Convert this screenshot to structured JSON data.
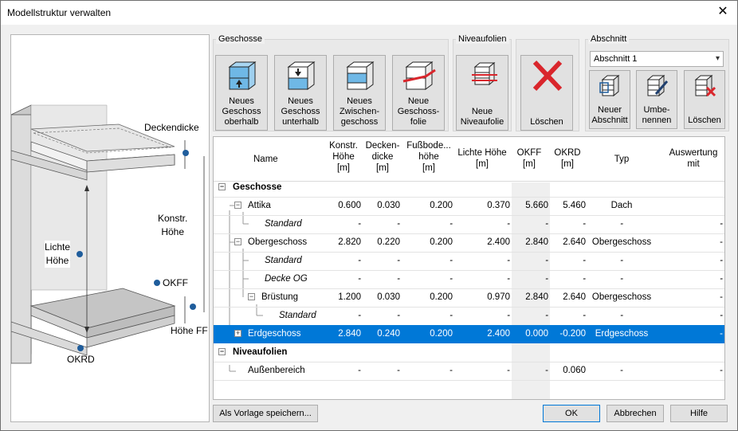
{
  "window": {
    "title": "Modellstruktur verwalten"
  },
  "illustration": {
    "deckendicke": "Deckendicke",
    "konstr_hoehe": "Konstr.\nHöhe",
    "lichte_hoehe": "Lichte\nHöhe",
    "okff": "OKFF",
    "hoehe_ff": "Höhe FF",
    "okrd": "OKRD"
  },
  "toolbar": {
    "geschosse_label": "Geschosse",
    "niveaufolien_label": "Niveaufolien",
    "abschnitt_label": "Abschnitt",
    "neues_geschoss_oberhalb": "Neues\nGeschoss\noberhalb",
    "neues_geschoss_unterhalb": "Neues\nGeschoss\nunterhalb",
    "neues_zwischengeschoss": "Neues\nZwischen-\ngeschoss",
    "neue_geschossfolie": "Neue\nGeschoss-\nfolie",
    "neue_niveaufolie": "Neue\nNiveaufolie",
    "loeschen": "Löschen",
    "abschnitt_selected": "Abschnitt 1",
    "neuer_abschnitt": "Neuer\nAbschnitt",
    "umbenennen": "Umbe-\nnennen",
    "abschnitt_loeschen": "Löschen"
  },
  "columns": {
    "name": "Name",
    "konstr": "Konstr.\nHöhe\n[m]",
    "decken": "Decken-\ndicke\n[m]",
    "fussboden": "Fußbode...\nhöhe\n[m]",
    "lichte": "Lichte Höhe\n[m]",
    "okff": "OKFF\n[m]",
    "okrd": "OKRD\n[m]",
    "typ": "Typ",
    "auswertung": "Auswertung\nmit"
  },
  "rows": [
    {
      "name": "Geschosse",
      "konstr": "",
      "decken": "",
      "fuss": "",
      "lichte": "",
      "okff": "",
      "okrd": "",
      "typ": "",
      "ausw": ""
    },
    {
      "name": "Attika",
      "konstr": "0.600",
      "decken": "0.030",
      "fuss": "0.200",
      "lichte": "0.370",
      "okff": "5.660",
      "okrd": "5.460",
      "typ": "Dach",
      "ausw": ""
    },
    {
      "name": "Standard",
      "konstr": "-",
      "decken": "-",
      "fuss": "-",
      "lichte": "-",
      "okff": "-",
      "okrd": "-",
      "typ": "-",
      "ausw": "-"
    },
    {
      "name": "Obergeschoss",
      "konstr": "2.820",
      "decken": "0.220",
      "fuss": "0.200",
      "lichte": "2.400",
      "okff": "2.840",
      "okrd": "2.640",
      "typ": "Obergeschoss",
      "ausw": "-"
    },
    {
      "name": "Standard",
      "konstr": "-",
      "decken": "-",
      "fuss": "-",
      "lichte": "-",
      "okff": "-",
      "okrd": "-",
      "typ": "-",
      "ausw": "-"
    },
    {
      "name": "Decke OG",
      "konstr": "-",
      "decken": "-",
      "fuss": "-",
      "lichte": "-",
      "okff": "-",
      "okrd": "-",
      "typ": "-",
      "ausw": "-"
    },
    {
      "name": "Brüstung",
      "konstr": "1.200",
      "decken": "0.030",
      "fuss": "0.200",
      "lichte": "0.970",
      "okff": "2.840",
      "okrd": "2.640",
      "typ": "Obergeschoss",
      "ausw": "-"
    },
    {
      "name": "Standard",
      "konstr": "-",
      "decken": "-",
      "fuss": "-",
      "lichte": "-",
      "okff": "-",
      "okrd": "-",
      "typ": "-",
      "ausw": "-"
    },
    {
      "name": "Erdgeschoss",
      "konstr": "2.840",
      "decken": "0.240",
      "fuss": "0.200",
      "lichte": "2.400",
      "okff": "0.000",
      "okrd": "-0.200",
      "typ": "Erdgeschoss",
      "ausw": "-"
    },
    {
      "name": "Niveaufolien",
      "konstr": "",
      "decken": "",
      "fuss": "",
      "lichte": "",
      "okff": "",
      "okrd": "",
      "typ": "",
      "ausw": ""
    },
    {
      "name": "Außenbereich",
      "konstr": "-",
      "decken": "-",
      "fuss": "-",
      "lichte": "-",
      "okff": "-",
      "okrd": "0.060",
      "typ": "-",
      "ausw": "-"
    }
  ],
  "buttons": {
    "vorlage": "Als Vorlage speichern...",
    "ok": "OK",
    "abbrechen": "Abbrechen",
    "hilfe": "Hilfe"
  },
  "colors": {
    "selection": "#0078d7",
    "delete_red": "#d9262c",
    "plan_blue": "#6fb8e6"
  }
}
